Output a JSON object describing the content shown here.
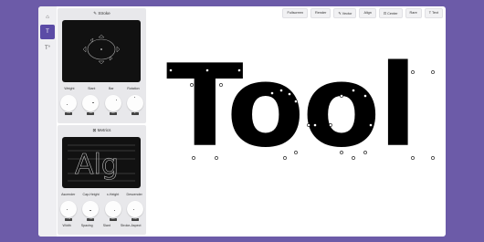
{
  "rail": {
    "items": [
      {
        "icon": "home-icon",
        "glyph": "⌂"
      },
      {
        "icon": "text-tool-icon",
        "glyph": "T",
        "active": true
      },
      {
        "icon": "text-style-icon",
        "glyph": "T°"
      }
    ]
  },
  "stroke_panel": {
    "title": "Stroke",
    "icon": "pen-icon",
    "knobs": [
      {
        "label": "Weight",
        "value": "100"
      },
      {
        "label": "Slant",
        "value": "100"
      },
      {
        "label": "Bar",
        "value": "100"
      },
      {
        "label": "Rotation",
        "value": "0°"
      }
    ]
  },
  "metrics_panel": {
    "title": "Metrics",
    "icon": "metrics-icon",
    "preview_text": "Alg",
    "knob_labels_top": [
      "Ascender",
      "Cap-Height",
      "x-Height",
      "Descender"
    ],
    "knob_labels_bottom": [
      "Width",
      "Spacing",
      "Slant",
      "Stroke-Aspect"
    ],
    "knobs": [
      {
        "value": "714"
      },
      {
        "value": "700"
      },
      {
        "value": "500"
      },
      {
        "value": "200"
      }
    ]
  },
  "toolbar": {
    "buttons": [
      {
        "label": "Fullscreen"
      },
      {
        "label": "Render"
      },
      {
        "label": "Vector",
        "icon": "pen-icon"
      },
      {
        "label": "Align"
      },
      {
        "label": "Center",
        "icon": "center-icon"
      },
      {
        "label": "Rare"
      },
      {
        "label": "Text",
        "icon": "text-icon"
      }
    ]
  },
  "canvas": {
    "text": "Tool"
  }
}
